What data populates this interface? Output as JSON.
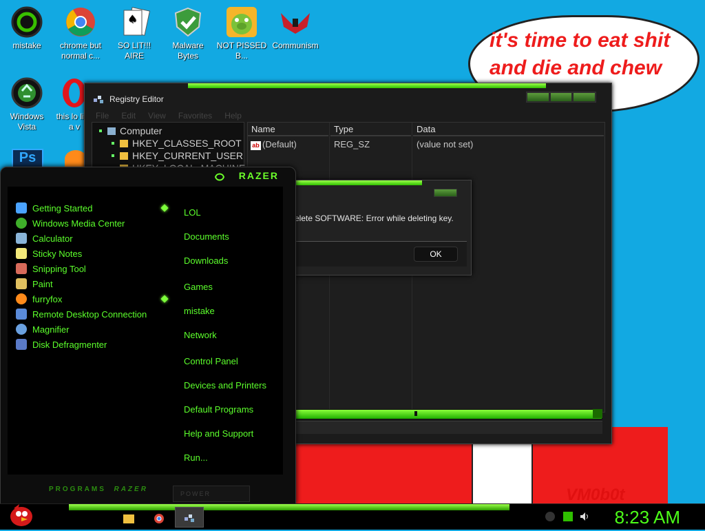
{
  "desktop_icons": [
    {
      "label": "mistake",
      "icon": "razer-snake-icon"
    },
    {
      "label": "chrome but normal c...",
      "icon": "chrome-icon"
    },
    {
      "label": "SO LIT!!! AIRE",
      "icon": "solitaire-icon"
    },
    {
      "label": "Malware Bytes",
      "icon": "malwarebytes-icon"
    },
    {
      "label": "NOT PISSED B...",
      "icon": "angry-pig-icon"
    },
    {
      "label": "Communism",
      "icon": "communism-icon"
    },
    {
      "label": "Windows Vista",
      "icon": "recycle-icon"
    },
    {
      "label": "this lo like a v",
      "icon": "opera-icon"
    }
  ],
  "speech_bubble": {
    "line1": "it's time to eat shit",
    "line2": "and die and chew"
  },
  "signature": "VM0b0t",
  "registry_editor": {
    "title": "Registry Editor",
    "menu": [
      "File",
      "Edit",
      "View",
      "Favorites",
      "Help"
    ],
    "tree": [
      "Computer",
      "HKEY_CLASSES_ROOT",
      "HKEY_CURRENT_USER",
      "HKEY_LOCAL_MACHINE"
    ],
    "columns": [
      "Name",
      "Type",
      "Data"
    ],
    "rows": [
      {
        "name": "(Default)",
        "type": "REG_SZ",
        "data": "(value not set)"
      }
    ]
  },
  "dialog": {
    "message": "elete SOFTWARE:  Error while deleting key.",
    "ok_label": "OK"
  },
  "start_menu": {
    "brand": "RAZER",
    "programs": [
      {
        "label": "Getting Started",
        "icon": "getting-started-icon",
        "color": "#4aa3ff"
      },
      {
        "label": "Windows Media Center",
        "icon": "media-center-icon",
        "color": "#3fae2a"
      },
      {
        "label": "Calculator",
        "icon": "calculator-icon",
        "color": "#8ab4d8"
      },
      {
        "label": "Sticky Notes",
        "icon": "sticky-notes-icon",
        "color": "#f3e87a"
      },
      {
        "label": "Snipping Tool",
        "icon": "snipping-tool-icon",
        "color": "#d86a5a"
      },
      {
        "label": "Paint",
        "icon": "paint-icon",
        "color": "#e0c060"
      },
      {
        "label": "furryfox",
        "icon": "firefox-icon",
        "color": "#ff8a1a"
      },
      {
        "label": "Remote Desktop Connection",
        "icon": "remote-desktop-icon",
        "color": "#5a8ad8"
      },
      {
        "label": "Magnifier",
        "icon": "magnifier-icon",
        "color": "#6aa0e0"
      },
      {
        "label": "Disk Defragmenter",
        "icon": "defrag-icon",
        "color": "#5a7ac8"
      }
    ],
    "places": [
      "LOL",
      "Documents",
      "Downloads",
      "Games",
      "mistake",
      "Network",
      "Control Panel",
      "Devices and Printers",
      "Default Programs",
      "Help and Support",
      "Run..."
    ],
    "footer_programs": "PROGRAMS",
    "footer_brand": "RAZER",
    "power_label": "POWER"
  },
  "taskbar": {
    "clock": "8:23 AM"
  },
  "colors": {
    "accent": "#5cff2c",
    "desktop": "#12a9e2",
    "bubble_text": "#ee1c1c"
  }
}
